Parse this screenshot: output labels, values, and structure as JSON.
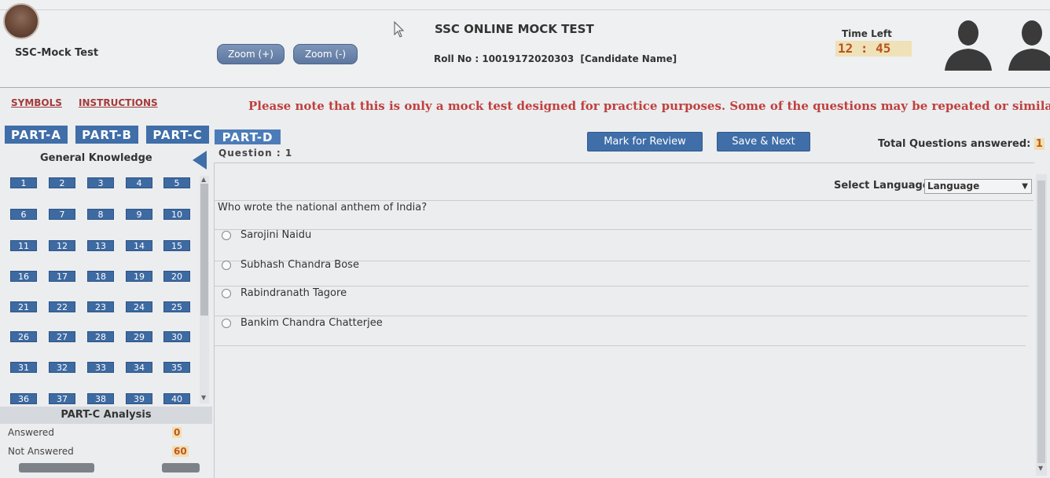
{
  "header": {
    "app_name": "SSC-Mock Test",
    "zoom_in_label": "Zoom (+)",
    "zoom_out_label": "Zoom (-)",
    "title": "SSC ONLINE MOCK TEST",
    "roll_label": "Roll No : 10019172020303",
    "candidate_name": "[Candidate Name]",
    "time_left_label": "Time Left",
    "time_left_value": "12 : 45"
  },
  "nav": {
    "symbols": "SYMBOLS",
    "instructions": "INSTRUCTIONS",
    "notice": "Please note that this is only a mock test designed for practice purposes. Some of the questions may be repeated or similar."
  },
  "parts": [
    "PART-A",
    "PART-B",
    "PART-C",
    "PART-D"
  ],
  "section": "General Knowledge",
  "palette": [
    "1",
    "2",
    "3",
    "4",
    "5",
    "6",
    "7",
    "8",
    "9",
    "10",
    "11",
    "12",
    "13",
    "14",
    "15",
    "16",
    "17",
    "18",
    "19",
    "20",
    "21",
    "22",
    "23",
    "24",
    "25",
    "26",
    "27",
    "28",
    "29",
    "30",
    "31",
    "32",
    "33",
    "34",
    "35",
    "36",
    "37",
    "38",
    "39",
    "40"
  ],
  "analysis": {
    "title": "PART-C Analysis",
    "answered_label": "Answered",
    "answered_value": "0",
    "not_answered_label": "Not Answered",
    "not_answered_value": "60"
  },
  "question": {
    "label": "Question : 1",
    "mark_review": "Mark for Review",
    "save_next": "Save & Next",
    "total_answered_label": "Total Questions answered:",
    "total_answered_value": "1",
    "language_label": "Select Language:",
    "language_value": "Language",
    "text": "Who wrote the national anthem of India?",
    "options": [
      "Sarojini Naidu",
      "Subhash Chandra Bose",
      "Rabindranath Tagore",
      "Bankim Chandra Chatterjee"
    ]
  },
  "colors": {
    "primary_blue": "#3f6ea8",
    "notice_red": "#c0403e",
    "timer_orange": "#b8541c",
    "timer_bg": "#efe1b8"
  }
}
